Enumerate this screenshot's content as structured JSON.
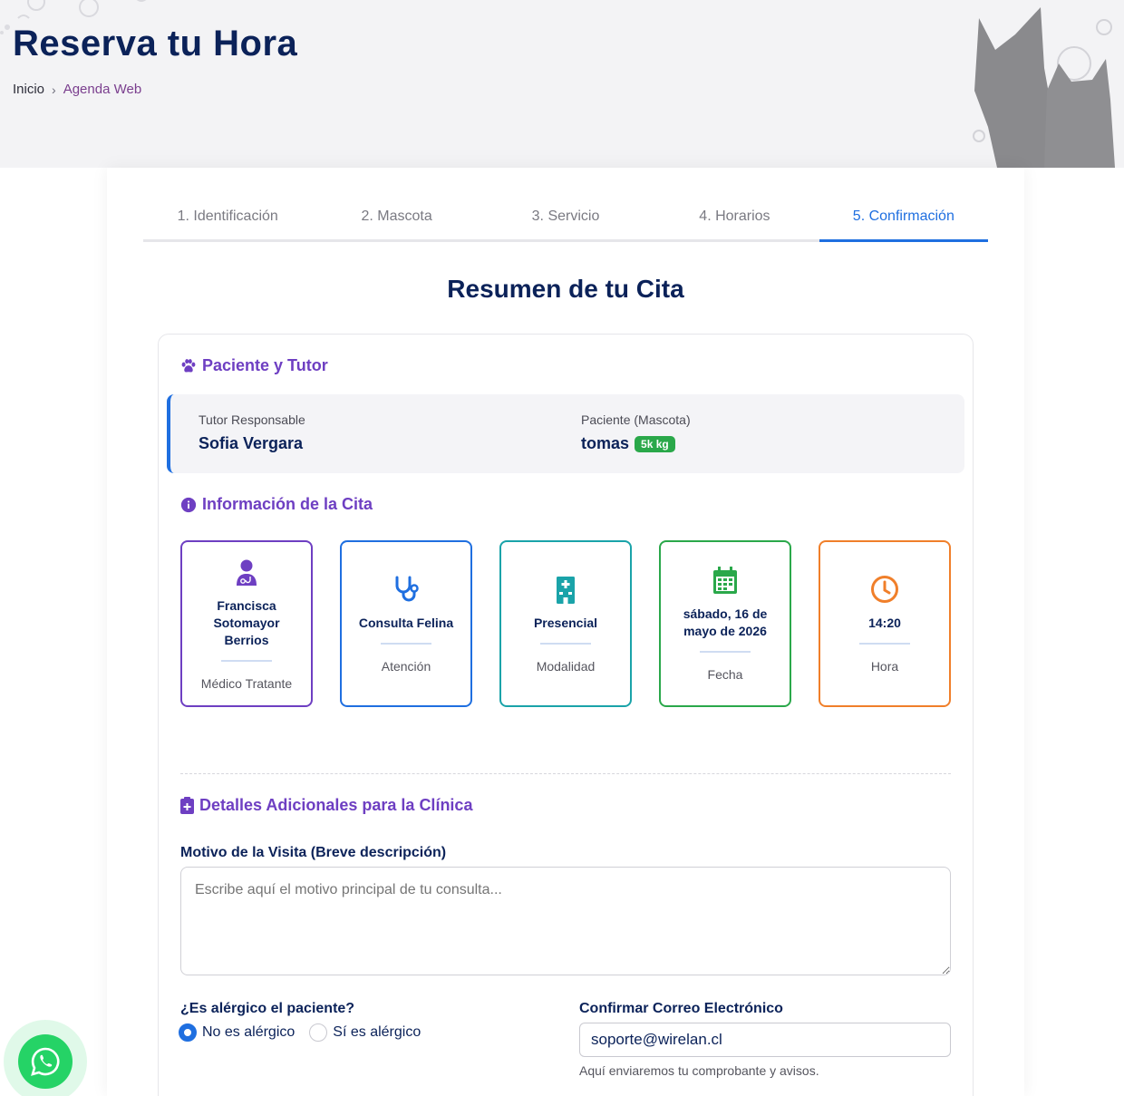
{
  "header": {
    "title": "Reserva tu Hora",
    "breadcrumb": {
      "home": "Inicio",
      "separator": "›",
      "current": "Agenda Web"
    }
  },
  "steps": [
    {
      "label": "1. Identificación",
      "active": false
    },
    {
      "label": "2. Mascota",
      "active": false
    },
    {
      "label": "3. Servicio",
      "active": false
    },
    {
      "label": "4. Horarios",
      "active": false
    },
    {
      "label": "5. Confirmación",
      "active": true
    }
  ],
  "summary": {
    "title": "Resumen de tu Cita",
    "patient_section": {
      "heading": "Paciente y Tutor",
      "icon": "paw-icon",
      "tutor_label": "Tutor Responsable",
      "tutor_value": "Sofia Vergara",
      "pet_label": "Paciente (Mascota)",
      "pet_value": "tomas",
      "pet_weight": "5k kg"
    },
    "appointment_section": {
      "heading": "Información de la Cita",
      "icon": "info-circle-icon",
      "tiles": [
        {
          "value": "Francisca Sotomayor Berrios",
          "label": "Médico Tratante",
          "icon": "doctor-icon",
          "color": "#6e3fc2"
        },
        {
          "value": "Consulta Felina",
          "label": "Atención",
          "icon": "stethoscope-icon",
          "color": "#1f6fe0"
        },
        {
          "value": "Presencial",
          "label": "Modalidad",
          "icon": "hospital-icon",
          "color": "#1aa3a9"
        },
        {
          "value": "sábado, 16 de mayo de 2026",
          "label": "Fecha",
          "icon": "calendar-icon",
          "color": "#2aa84a"
        },
        {
          "value": "14:20",
          "label": "Hora",
          "icon": "clock-icon",
          "color": "#f07f2a"
        }
      ]
    },
    "details_section": {
      "heading": "Detalles Adicionales para la Clínica",
      "icon": "clipboard-medical-icon",
      "reason_label": "Motivo de la Visita (Breve descripción)",
      "reason_value": "",
      "reason_placeholder": "Escribe aquí el motivo principal de tu consulta...",
      "allergy_label": "¿Es alérgico el paciente?",
      "allergy_options": [
        {
          "label": "No es alérgico",
          "selected": true
        },
        {
          "label": "Sí es alérgico",
          "selected": false
        }
      ],
      "email_label": "Confirmar Correo Electrónico",
      "email_value": "soporte@wirelan.cl",
      "email_help": "Aquí enviaremos tu comprobante y avisos."
    }
  },
  "colors": {
    "navy": "#0b2259",
    "accent_blue": "#1f6fe0",
    "purple": "#6e3fc2",
    "whatsapp": "#25d366"
  },
  "floating": {
    "icon": "whatsapp-icon"
  }
}
